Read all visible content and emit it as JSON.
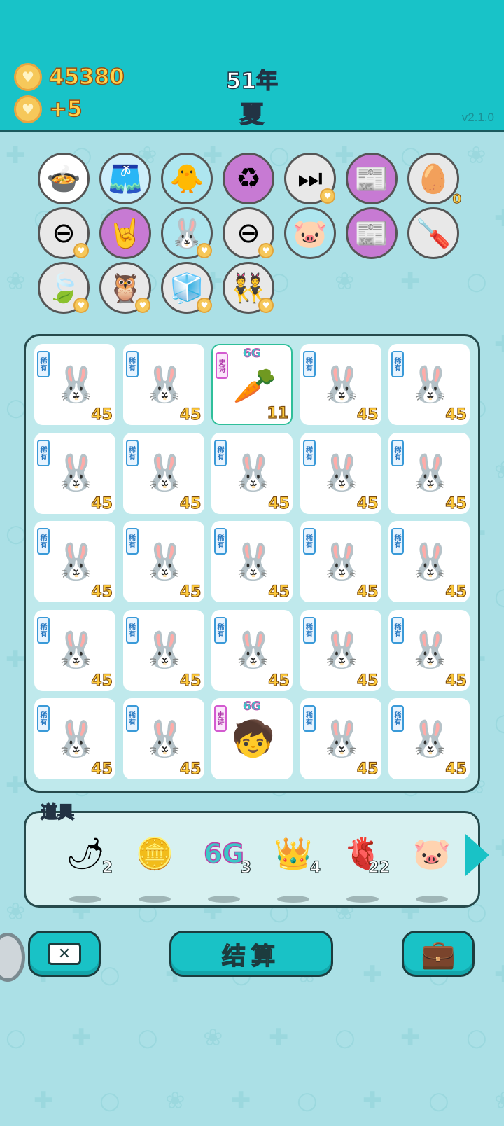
{
  "header": {
    "coins": "45380",
    "income": "+5",
    "year": "51年",
    "season": "夏",
    "version": "v2.1.0"
  },
  "owned_items": [
    {
      "name": "pot-duck",
      "glyph": "🍲",
      "bg": "#ffffff",
      "heart": false
    },
    {
      "name": "skirt",
      "glyph": "🩳",
      "bg": "#cdeefa",
      "heart": false
    },
    {
      "name": "chick-egg",
      "glyph": "🐥",
      "bg": "#aee6ef",
      "heart": false
    },
    {
      "name": "recycle",
      "glyph": "♻",
      "bg": "#c77ad3",
      "heart": false
    },
    {
      "name": "skip",
      "glyph": "⏭",
      "bg": "#e8e8e8",
      "heart": true
    },
    {
      "name": "time-magazine",
      "glyph": "📰",
      "bg": "#c77ad3",
      "heart": false
    },
    {
      "name": "egg-tray",
      "glyph": "🥚",
      "bg": "#e8e8e8",
      "heart": false,
      "count": "0"
    },
    {
      "name": "remove",
      "glyph": "⊖",
      "bg": "#e8e8e8",
      "heart": true
    },
    {
      "name": "rock-hand",
      "glyph": "🤘",
      "bg": "#c77ad3",
      "heart": false
    },
    {
      "name": "rabbit",
      "glyph": "🐰",
      "bg": "#aee6ef",
      "heart": true
    },
    {
      "name": "remove-2",
      "glyph": "⊖",
      "bg": "#e8e8e8",
      "heart": true
    },
    {
      "name": "piggy",
      "glyph": "🐷",
      "bg": "#aee6ef",
      "heart": false
    },
    {
      "name": "time-magazine-2",
      "glyph": "📰",
      "bg": "#c77ad3",
      "heart": false
    },
    {
      "name": "screwdriver",
      "glyph": "🪛",
      "bg": "#e8e8e8",
      "heart": false
    },
    {
      "name": "leaf",
      "glyph": "🍃",
      "bg": "#e8e8e8",
      "heart": true
    },
    {
      "name": "owls",
      "glyph": "🦉",
      "bg": "#e8e8e8",
      "heart": true
    },
    {
      "name": "sugar-cubes",
      "glyph": "🧊",
      "bg": "#e8e8e8",
      "heart": true
    },
    {
      "name": "twins",
      "glyph": "👯",
      "bg": "#e8e8e8",
      "heart": true
    }
  ],
  "board": {
    "rare_label": "稀有",
    "epic_label": "史诗",
    "tiles": [
      {
        "kind": "rabbit",
        "tag": "rare",
        "value": "45"
      },
      {
        "kind": "rabbit",
        "tag": "rare",
        "value": "45"
      },
      {
        "kind": "carrot",
        "tag": "epic",
        "value": "11",
        "mark": "6G",
        "selected": true
      },
      {
        "kind": "rabbit",
        "tag": "rare",
        "value": "45"
      },
      {
        "kind": "rabbit",
        "tag": "rare",
        "value": "45"
      },
      {
        "kind": "rabbit",
        "tag": "rare",
        "value": "45"
      },
      {
        "kind": "rabbit",
        "tag": "rare",
        "value": "45"
      },
      {
        "kind": "rabbit",
        "tag": "rare",
        "value": "45"
      },
      {
        "kind": "rabbit",
        "tag": "rare",
        "value": "45"
      },
      {
        "kind": "rabbit",
        "tag": "rare",
        "value": "45"
      },
      {
        "kind": "rabbit",
        "tag": "rare",
        "value": "45"
      },
      {
        "kind": "rabbit",
        "tag": "rare",
        "value": "45"
      },
      {
        "kind": "rabbit",
        "tag": "rare",
        "value": "45"
      },
      {
        "kind": "rabbit",
        "tag": "rare",
        "value": "45"
      },
      {
        "kind": "rabbit",
        "tag": "rare",
        "value": "45"
      },
      {
        "kind": "rabbit",
        "tag": "rare",
        "value": "45"
      },
      {
        "kind": "rabbit",
        "tag": "rare",
        "value": "45"
      },
      {
        "kind": "rabbit",
        "tag": "rare",
        "value": "45"
      },
      {
        "kind": "rabbit",
        "tag": "rare",
        "value": "45"
      },
      {
        "kind": "rabbit",
        "tag": "rare",
        "value": "45"
      },
      {
        "kind": "rabbit",
        "tag": "rare",
        "value": "45"
      },
      {
        "kind": "rabbit",
        "tag": "rare",
        "value": "45"
      },
      {
        "kind": "boy",
        "tag": "epic",
        "value": "",
        "mark": "6G"
      },
      {
        "kind": "rabbit",
        "tag": "rare",
        "value": "45"
      },
      {
        "kind": "rabbit",
        "tag": "rare",
        "value": "45"
      }
    ],
    "glyphs": {
      "rabbit": "🐰",
      "carrot": "🥕",
      "boy": "🧒"
    }
  },
  "props": {
    "title": "道具",
    "items": [
      {
        "name": "chili",
        "glyph": "🌶",
        "count": "2"
      },
      {
        "name": "coin",
        "glyph": "🪙",
        "count": ""
      },
      {
        "name": "6g",
        "glyph": "6G",
        "count": "3"
      },
      {
        "name": "crown",
        "glyph": "👑",
        "count": "4"
      },
      {
        "name": "liver",
        "glyph": "🫀",
        "count": "22"
      },
      {
        "name": "piggy-bank",
        "glyph": "🐷",
        "count": ""
      }
    ]
  },
  "buttons": {
    "close_glyph": "✕",
    "settle_label": "结算",
    "bag_glyph": "💼"
  }
}
